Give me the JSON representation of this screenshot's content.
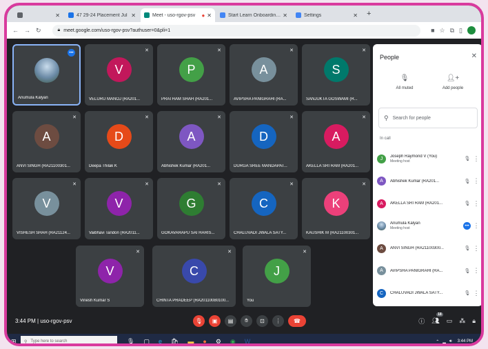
{
  "tabs": [
    {
      "label": "",
      "color": "#5f6368",
      "active": false
    },
    {
      "label": "47 29-24 Placement Jul",
      "color": "#1a73e8",
      "active": false
    },
    {
      "label": "Meet - uso-rgov-psv",
      "color": "#00897b",
      "active": true
    },
    {
      "label": "Start Learn Onboarding (Lesson",
      "color": "#4285f4",
      "active": false
    },
    {
      "label": "Settings",
      "color": "#4285f4",
      "active": false
    }
  ],
  "address": {
    "url": "meet.google.com/uso-rgov-psv?authuser=0&pli=1"
  },
  "tiles": [
    {
      "name": "Anumula Kalyan",
      "initial": "",
      "color": "",
      "photo": true,
      "mic": "on",
      "self": true
    },
    {
      "name": "VELURU MANOJ (RA201...",
      "initial": "V",
      "color": "#c2185b",
      "mic": "off"
    },
    {
      "name": "PRATHAM SHAH (RA201...",
      "initial": "P",
      "color": "#43a047",
      "mic": "off"
    },
    {
      "name": "AVIPSHA PANIGRAHI (RA...",
      "initial": "A",
      "color": "#78909c",
      "mic": "off"
    },
    {
      "name": "SANJUKTA GOSWAMI (R...",
      "initial": "S",
      "color": "#00796b",
      "mic": "off"
    },
    {
      "name": "ANVI SINGH (RA21100301...",
      "initial": "A",
      "color": "#6d4c41",
      "mic": "off"
    },
    {
      "name": "Deepa Thilak K",
      "initial": "D",
      "color": "#e64a19",
      "mic": "off"
    },
    {
      "name": "Abhishek Kumar (RA201...",
      "initial": "A",
      "color": "#7e57c2",
      "mic": "off"
    },
    {
      "name": "DURGA SREE MANDAPAT...",
      "initial": "D",
      "color": "#1565c0",
      "mic": "off"
    },
    {
      "name": "AKELLA SRI RAM (RA201...",
      "initial": "A",
      "color": "#d81b60",
      "mic": "off"
    },
    {
      "name": "VISHESH SHAH (RA21124...",
      "initial": "V",
      "color": "#78909c",
      "mic": "off"
    },
    {
      "name": "Vaibhavi Tandon (RA2011...",
      "initial": "V",
      "color": "#8e24aa",
      "mic": "off"
    },
    {
      "name": "GOKAVARAPU SAI HARIS...",
      "initial": "G",
      "color": "#2e7d32",
      "mic": "off"
    },
    {
      "name": "CHALUVADI JWALA SATY...",
      "initial": "C",
      "color": "#1565c0",
      "mic": "off"
    },
    {
      "name": "KAUSHIK M (RA21100301...",
      "initial": "K",
      "color": "#ec407a",
      "mic": "off"
    },
    {
      "name": "Vinesh Kumar S",
      "initial": "V",
      "color": "#8e24aa",
      "mic": "off"
    },
    {
      "name": "CHINTA PRADEEP (RA20110080100...",
      "initial": "C",
      "color": "#3949ab",
      "mic": "off"
    },
    {
      "name": "You",
      "initial": "J",
      "color": "#43a047",
      "mic": "off"
    }
  ],
  "people": {
    "title": "People",
    "all_muted": "All muted",
    "add_people": "Add people",
    "search_placeholder": "Search for people",
    "in_call": "In call",
    "list": [
      {
        "name": "Joseph Raymond V (You)",
        "sub": "Meeting host",
        "initial": "J",
        "color": "#43a047",
        "mic": "off"
      },
      {
        "name": "Abhishek Kumar (RA201...",
        "sub": "",
        "initial": "A",
        "color": "#7e57c2",
        "mic": "off"
      },
      {
        "name": "AKELLA SRI RAM (RA201...",
        "sub": "",
        "initial": "A",
        "color": "#d81b60",
        "mic": "off"
      },
      {
        "name": "Anumula Kalyan",
        "sub": "Meeting host",
        "initial": "",
        "color": "#6b8aa6",
        "photo": true,
        "mic": "on"
      },
      {
        "name": "ANVI SINGH (RA21100300...",
        "sub": "",
        "initial": "A",
        "color": "#6d4c41",
        "mic": "off"
      },
      {
        "name": "AVIPSHA PANIGRAHI (RA...",
        "sub": "",
        "initial": "A",
        "color": "#78909c",
        "mic": "off"
      },
      {
        "name": "CHALUVADI JWALA SATY...",
        "sub": "",
        "initial": "C",
        "color": "#1565c0",
        "mic": "off"
      }
    ]
  },
  "meetbar": {
    "time_code": "3:44 PM  |  uso-rgov-psv"
  },
  "taskbar": {
    "search": "Type here to search",
    "time": "3:44 PM"
  }
}
